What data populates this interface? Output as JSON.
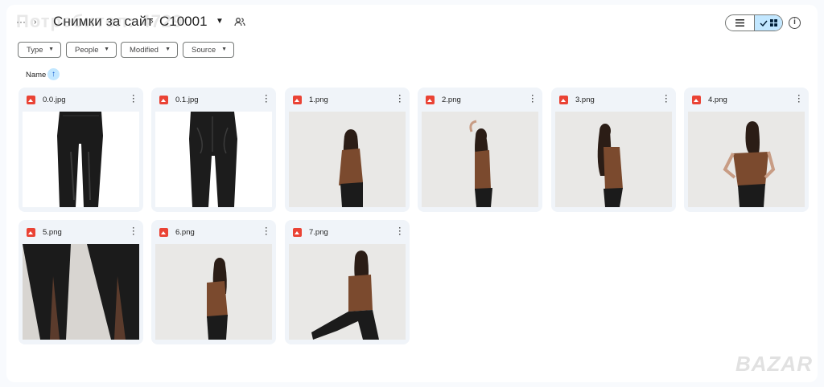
{
  "header": {
    "more": "···",
    "folder": "Снимки за сайт",
    "current": "C10001",
    "watermark": "Потребител: 4729",
    "view_list_icon": "list-icon",
    "view_grid_icon": "grid-icon",
    "info_icon": "info-icon"
  },
  "filters": [
    {
      "label": "Type"
    },
    {
      "label": "People"
    },
    {
      "label": "Modified"
    },
    {
      "label": "Source"
    }
  ],
  "sort": {
    "label": "Name",
    "direction": "ascending"
  },
  "files": [
    {
      "name": "0.0.jpg",
      "thumb": "black-leather-pants-front"
    },
    {
      "name": "0.1.jpg",
      "thumb": "black-leather-pants-back"
    },
    {
      "name": "1.png",
      "thumb": "model-brown-top-front"
    },
    {
      "name": "2.png",
      "thumb": "model-brown-top-side-arm-raised"
    },
    {
      "name": "3.png",
      "thumb": "model-brown-top-side"
    },
    {
      "name": "4.png",
      "thumb": "model-brown-top-back"
    },
    {
      "name": "5.png",
      "thumb": "pants-slit-closeup"
    },
    {
      "name": "6.png",
      "thumb": "model-brown-top-three-quarter"
    },
    {
      "name": "7.png",
      "thumb": "model-brown-top-seated"
    }
  ],
  "brand_watermark": "BAZAR",
  "colors": {
    "accent": "#c2e7ff",
    "card_bg": "#f0f4f9",
    "image_icon": "#ea4335",
    "top": "#7b4a2e",
    "pants": "#1b1b1b"
  }
}
